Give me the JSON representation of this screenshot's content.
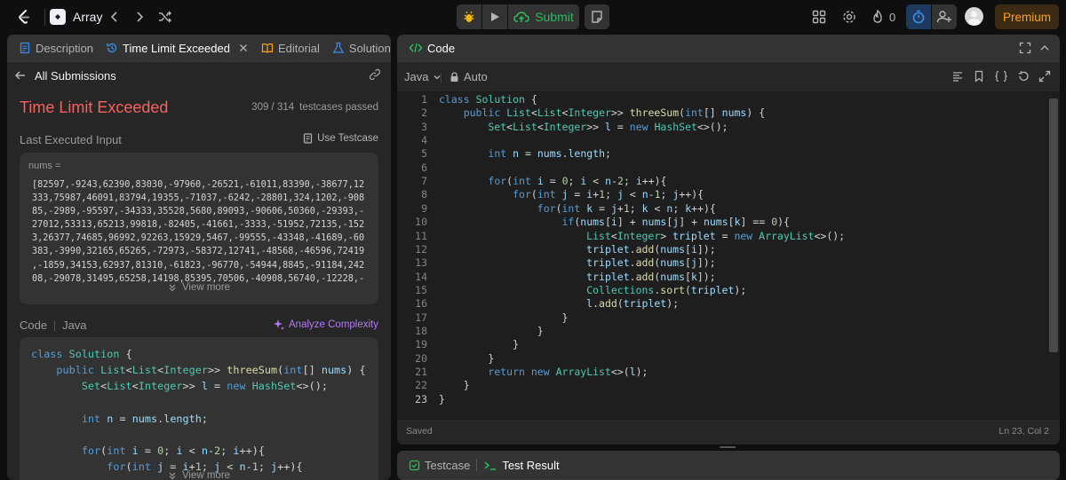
{
  "topbar": {
    "problem_list_label": "Array",
    "submit_label": "Submit",
    "streak_count": "0",
    "premium_label": "Premium"
  },
  "left": {
    "tabs": {
      "description": "Description",
      "submission": "Time Limit Exceeded",
      "editorial": "Editorial",
      "solutions": "Solutions"
    },
    "back_label": "All Submissions",
    "status": "Time Limit Exceeded",
    "testcases_count": "309 / 314",
    "testcases_label": "testcases passed",
    "last_input_label": "Last Executed Input",
    "use_testcase_label": "Use Testcase",
    "input_var": "nums =",
    "input_lines": [
      "[82597,-9243,62390,83030,-97960,-26521,-61011,83390,-38677,12",
      "333,75987,46091,83794,19355,-71037,-6242,-28801,324,1202,-908",
      "85,-2989,-95597,-34333,35528,5680,89093,-90606,50360,-29393,-",
      "27012,53313,65213,99818,-82405,-41661,-3333,-51952,72135,-152",
      "3,26377,74685,96992,92263,15929,5467,-99555,-43348,-41689,-60",
      "383,-3990,32165,65265,-72973,-58372,12741,-48568,-46596,72419",
      ",-1859,34153,62937,81310,-61823,-96770,-54944,8845,-91184,242",
      "08,-29078,31495,65258,14198,85395,70506,-40908,56740,-12228,-"
    ],
    "view_more": "View more",
    "code_label": "Code",
    "lang_label": "Java",
    "analyze_label": "Analyze Complexity",
    "view_more_2": "View more"
  },
  "right": {
    "tab_label": "Code",
    "lang": "Java",
    "auto_label": "Auto",
    "status_saved": "Saved",
    "cursor_pos": "Ln 23, Col 2"
  },
  "bottom": {
    "testcase_label": "Testcase",
    "result_label": "Test Result"
  },
  "code_lines": [
    "class Solution {",
    "    public List<List<Integer>> threeSum(int[] nums) {",
    "        Set<List<Integer>> l = new HashSet<>();",
    "",
    "        int n = nums.length;",
    "",
    "        for(int i = 0; i < n-2; i++){",
    "            for(int j = i+1; j < n-1; j++){",
    "                for(int k = j+1; k < n; k++){",
    "                    if(nums[i] + nums[j] + nums[k] == 0){",
    "                        List<Integer> triplet = new ArrayList<>();",
    "                        triplet.add(nums[i]);",
    "                        triplet.add(nums[j]);",
    "                        triplet.add(nums[k]);",
    "                        Collections.sort(triplet);",
    "                        l.add(triplet);",
    "                    }",
    "                }",
    "            }",
    "        }",
    "        return new ArrayList<>(l);",
    "    }",
    "}"
  ],
  "colors": {
    "status_red": "#f8615c",
    "submit_green": "#2cbb5d",
    "premium_orange": "#ffa116",
    "link_blue": "#3c8ce7",
    "analyze_purple": "#b27cf0"
  }
}
